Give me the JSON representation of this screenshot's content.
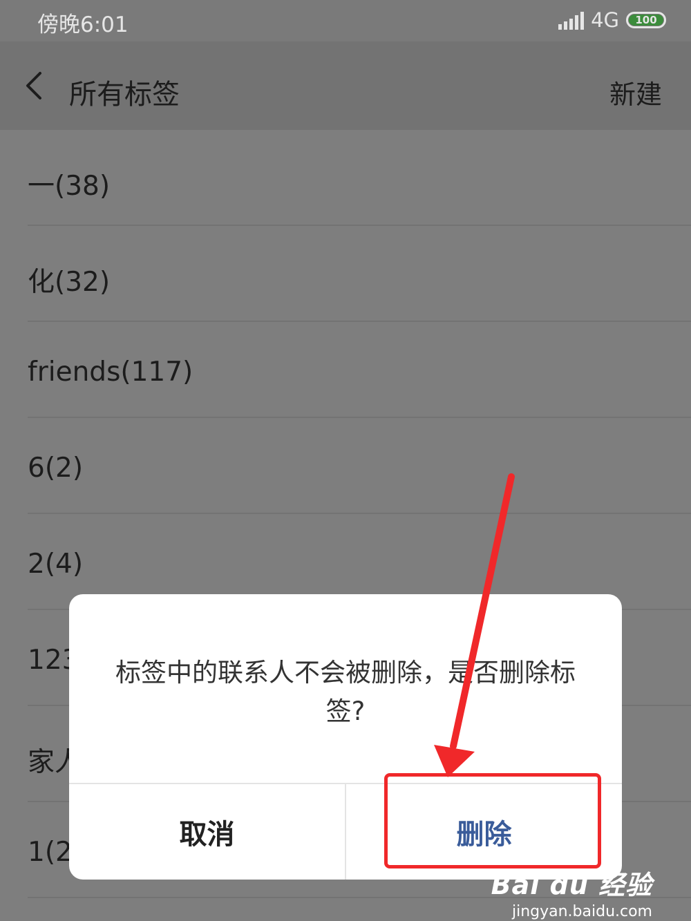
{
  "status_bar": {
    "time": "傍晚6:01",
    "network": "4G",
    "battery": "100"
  },
  "header": {
    "title": "所有标签",
    "new_label": "新建"
  },
  "tags": [
    "一(38)",
    "化(32)",
    "friends(117)",
    "6(2)",
    "2(4)",
    "123",
    "家人",
    "1(2"
  ],
  "dialog": {
    "message": "标签中的联系人不会被删除，是否删除标签?",
    "cancel_label": "取消",
    "delete_label": "删除"
  },
  "annotation": {
    "color": "#f0282a"
  },
  "watermark": {
    "logo": "Bai du 经验",
    "url": "jingyan.baidu.com"
  }
}
